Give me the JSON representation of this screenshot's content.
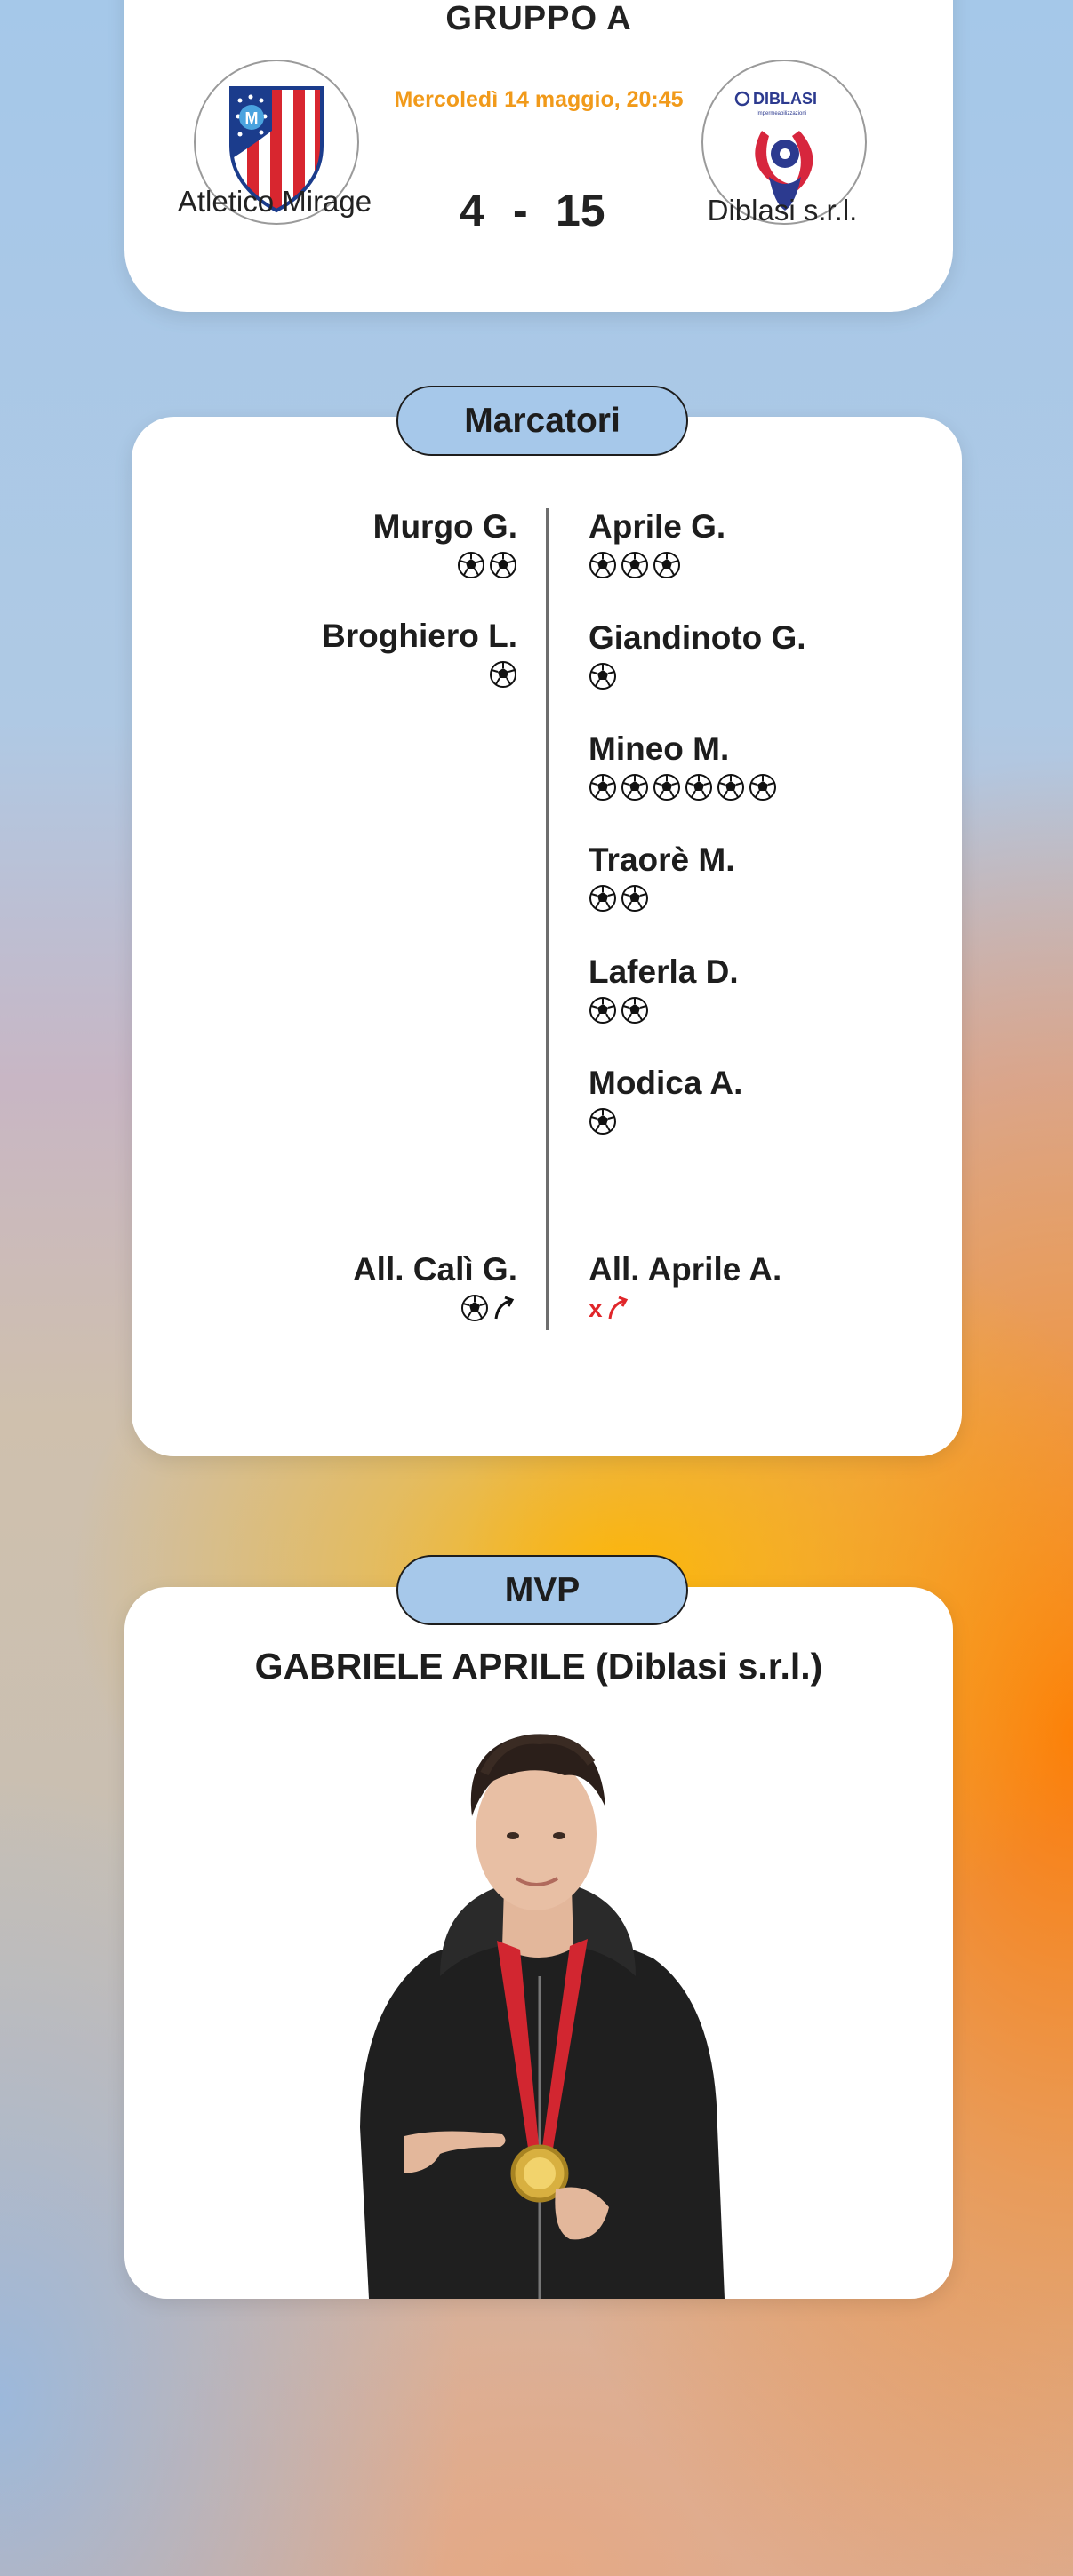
{
  "match": {
    "group": "GRUPPO A",
    "datetime": "Mercoledì 14 maggio, 20:45",
    "home": {
      "name": "Atletico Mirage",
      "score": "4",
      "logo": "atletico-mirage-crest"
    },
    "away": {
      "name": "Diblasi s.r.l.",
      "score": "15",
      "logo": "diblasi-logo",
      "logo_text": "DIBLASI",
      "logo_subtext": "Impermeabilizzazioni"
    },
    "separator": "-"
  },
  "scorers": {
    "title": "Marcatori",
    "home": [
      {
        "name": "Murgo G.",
        "goals": 2
      },
      {
        "name": "Broghiero L.",
        "goals": 1
      }
    ],
    "away": [
      {
        "name": "Aprile G.",
        "goals": 3
      },
      {
        "name": "Giandinoto G.",
        "goals": 1
      },
      {
        "name": "Mineo M.",
        "goals": 6
      },
      {
        "name": "Traorè M.",
        "goals": 2
      },
      {
        "name": "Laferla D.",
        "goals": 2
      },
      {
        "name": "Modica A.",
        "goals": 1
      }
    ],
    "home_coach": {
      "name": "All. Calì G.",
      "marker": "ball-arrow-icon"
    },
    "away_coach": {
      "name": "All. Aprile A.",
      "marker": "x-arrow-icon",
      "marker_text": "x"
    }
  },
  "mvp": {
    "title": "MVP",
    "player": "GABRIELE APRILE (Diblasi s.r.l.)",
    "photo": "mvp-player-photo"
  },
  "colors": {
    "pill": "#a6c8ea",
    "date_text": "#f19a1a",
    "coach_red_mark": "#e0262a",
    "atletico_red": "#d8262f",
    "atletico_blue": "#1b3c8c",
    "diblasi_blue": "#2c3a8f",
    "diblasi_red": "#d7263d"
  }
}
